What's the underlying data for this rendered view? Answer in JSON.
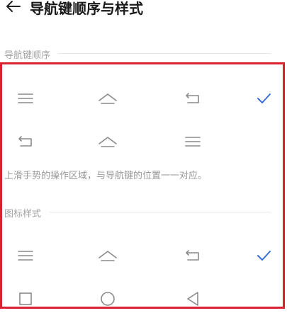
{
  "header": {
    "title": "导航键顺序与样式"
  },
  "nav_order": {
    "label": "导航键顺序",
    "options": [
      {
        "icons": [
          "menu-lines",
          "home-chevron",
          "back-arrow"
        ],
        "selected": true
      },
      {
        "icons": [
          "back-arrow",
          "home-chevron",
          "menu-lines"
        ],
        "selected": false
      }
    ],
    "hint": "上滑手势的操作区域，与导航键的位置一一对应。"
  },
  "icon_style": {
    "label": "图标样式",
    "options": [
      {
        "icons": [
          "menu-lines",
          "home-chevron",
          "back-arrow"
        ],
        "selected": true
      },
      {
        "icons": [
          "square",
          "circle",
          "triangle-left"
        ],
        "selected": false
      }
    ]
  },
  "colors": {
    "accent": "#3a6fd8",
    "highlight_border": "#d9212f",
    "icon": "#8a8a8a"
  }
}
